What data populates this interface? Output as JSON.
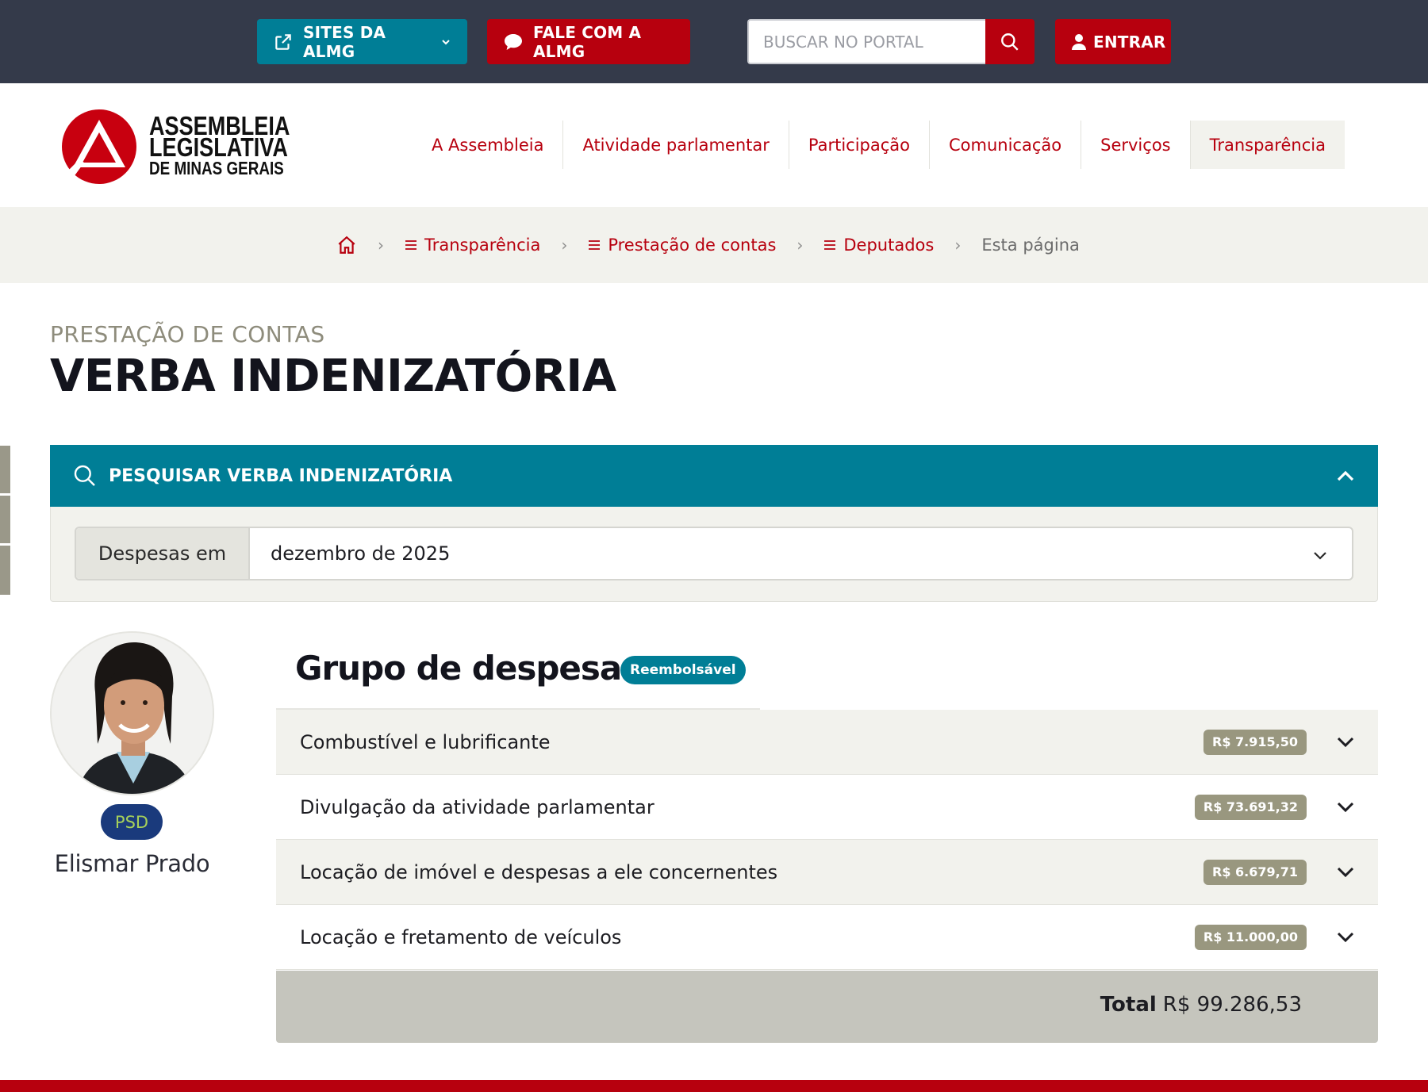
{
  "topbar": {
    "sites_label": "SITES DA ALMG",
    "fale_label": "FALE COM A ALMG",
    "search_placeholder": "BUSCAR NO PORTAL",
    "entrar_label": "ENTRAR"
  },
  "logo": {
    "line1": "ASSEMBLEIA",
    "line2": "LEGISLATIVA",
    "line3": "DE MINAS GERAIS"
  },
  "nav": {
    "items": [
      "A Assembleia",
      "Atividade parlamentar",
      "Participação",
      "Comunicação",
      "Serviços",
      "Transparência"
    ],
    "active": "Transparência"
  },
  "breadcrumb": {
    "items": [
      "Transparência",
      "Prestação de contas",
      "Deputados"
    ],
    "current": "Esta página"
  },
  "page": {
    "pre_title": "PRESTAÇÃO DE CONTAS",
    "title": "VERBA INDENIZATÓRIA"
  },
  "search_panel": {
    "title": "PESQUISAR VERBA INDENIZATÓRIA",
    "select_label": "Despesas em",
    "select_value": "dezembro de 2025"
  },
  "deputy": {
    "party": "PSD",
    "name": "Elismar Prado"
  },
  "expenses": {
    "title": "Grupo de despesas",
    "badge": "Reembolsável",
    "rows": [
      {
        "name": "Combustível e lubrificante",
        "amount": "R$ 7.915,50"
      },
      {
        "name": "Divulgação da atividade parlamentar",
        "amount": "R$ 73.691,32"
      },
      {
        "name": "Locação de imóvel e despesas a ele concernentes",
        "amount": "R$ 6.679,71"
      },
      {
        "name": "Locação e fretamento de veículos",
        "amount": "R$ 11.000,00"
      }
    ],
    "total_label": "Total",
    "total_value": "R$ 99.286,53"
  },
  "colors": {
    "brand_red": "#b7000e",
    "teal": "#007e96",
    "topbar_bg": "#343a4a"
  }
}
